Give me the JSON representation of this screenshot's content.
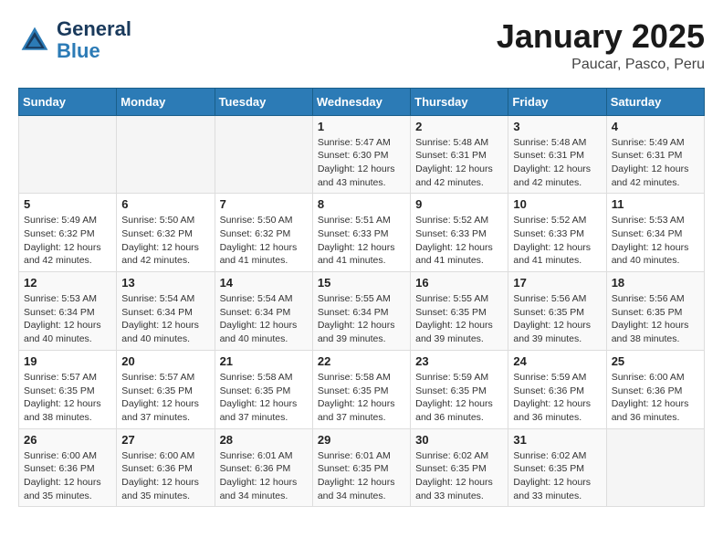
{
  "header": {
    "logo_line1": "General",
    "logo_line2": "Blue",
    "title": "January 2025",
    "subtitle": "Paucar, Pasco, Peru"
  },
  "days_of_week": [
    "Sunday",
    "Monday",
    "Tuesday",
    "Wednesday",
    "Thursday",
    "Friday",
    "Saturday"
  ],
  "weeks": [
    [
      {
        "day": "",
        "info": ""
      },
      {
        "day": "",
        "info": ""
      },
      {
        "day": "",
        "info": ""
      },
      {
        "day": "1",
        "info": "Sunrise: 5:47 AM\nSunset: 6:30 PM\nDaylight: 12 hours and 43 minutes."
      },
      {
        "day": "2",
        "info": "Sunrise: 5:48 AM\nSunset: 6:31 PM\nDaylight: 12 hours and 42 minutes."
      },
      {
        "day": "3",
        "info": "Sunrise: 5:48 AM\nSunset: 6:31 PM\nDaylight: 12 hours and 42 minutes."
      },
      {
        "day": "4",
        "info": "Sunrise: 5:49 AM\nSunset: 6:31 PM\nDaylight: 12 hours and 42 minutes."
      }
    ],
    [
      {
        "day": "5",
        "info": "Sunrise: 5:49 AM\nSunset: 6:32 PM\nDaylight: 12 hours and 42 minutes."
      },
      {
        "day": "6",
        "info": "Sunrise: 5:50 AM\nSunset: 6:32 PM\nDaylight: 12 hours and 42 minutes."
      },
      {
        "day": "7",
        "info": "Sunrise: 5:50 AM\nSunset: 6:32 PM\nDaylight: 12 hours and 41 minutes."
      },
      {
        "day": "8",
        "info": "Sunrise: 5:51 AM\nSunset: 6:33 PM\nDaylight: 12 hours and 41 minutes."
      },
      {
        "day": "9",
        "info": "Sunrise: 5:52 AM\nSunset: 6:33 PM\nDaylight: 12 hours and 41 minutes."
      },
      {
        "day": "10",
        "info": "Sunrise: 5:52 AM\nSunset: 6:33 PM\nDaylight: 12 hours and 41 minutes."
      },
      {
        "day": "11",
        "info": "Sunrise: 5:53 AM\nSunset: 6:34 PM\nDaylight: 12 hours and 40 minutes."
      }
    ],
    [
      {
        "day": "12",
        "info": "Sunrise: 5:53 AM\nSunset: 6:34 PM\nDaylight: 12 hours and 40 minutes."
      },
      {
        "day": "13",
        "info": "Sunrise: 5:54 AM\nSunset: 6:34 PM\nDaylight: 12 hours and 40 minutes."
      },
      {
        "day": "14",
        "info": "Sunrise: 5:54 AM\nSunset: 6:34 PM\nDaylight: 12 hours and 40 minutes."
      },
      {
        "day": "15",
        "info": "Sunrise: 5:55 AM\nSunset: 6:34 PM\nDaylight: 12 hours and 39 minutes."
      },
      {
        "day": "16",
        "info": "Sunrise: 5:55 AM\nSunset: 6:35 PM\nDaylight: 12 hours and 39 minutes."
      },
      {
        "day": "17",
        "info": "Sunrise: 5:56 AM\nSunset: 6:35 PM\nDaylight: 12 hours and 39 minutes."
      },
      {
        "day": "18",
        "info": "Sunrise: 5:56 AM\nSunset: 6:35 PM\nDaylight: 12 hours and 38 minutes."
      }
    ],
    [
      {
        "day": "19",
        "info": "Sunrise: 5:57 AM\nSunset: 6:35 PM\nDaylight: 12 hours and 38 minutes."
      },
      {
        "day": "20",
        "info": "Sunrise: 5:57 AM\nSunset: 6:35 PM\nDaylight: 12 hours and 37 minutes."
      },
      {
        "day": "21",
        "info": "Sunrise: 5:58 AM\nSunset: 6:35 PM\nDaylight: 12 hours and 37 minutes."
      },
      {
        "day": "22",
        "info": "Sunrise: 5:58 AM\nSunset: 6:35 PM\nDaylight: 12 hours and 37 minutes."
      },
      {
        "day": "23",
        "info": "Sunrise: 5:59 AM\nSunset: 6:35 PM\nDaylight: 12 hours and 36 minutes."
      },
      {
        "day": "24",
        "info": "Sunrise: 5:59 AM\nSunset: 6:36 PM\nDaylight: 12 hours and 36 minutes."
      },
      {
        "day": "25",
        "info": "Sunrise: 6:00 AM\nSunset: 6:36 PM\nDaylight: 12 hours and 36 minutes."
      }
    ],
    [
      {
        "day": "26",
        "info": "Sunrise: 6:00 AM\nSunset: 6:36 PM\nDaylight: 12 hours and 35 minutes."
      },
      {
        "day": "27",
        "info": "Sunrise: 6:00 AM\nSunset: 6:36 PM\nDaylight: 12 hours and 35 minutes."
      },
      {
        "day": "28",
        "info": "Sunrise: 6:01 AM\nSunset: 6:36 PM\nDaylight: 12 hours and 34 minutes."
      },
      {
        "day": "29",
        "info": "Sunrise: 6:01 AM\nSunset: 6:35 PM\nDaylight: 12 hours and 34 minutes."
      },
      {
        "day": "30",
        "info": "Sunrise: 6:02 AM\nSunset: 6:35 PM\nDaylight: 12 hours and 33 minutes."
      },
      {
        "day": "31",
        "info": "Sunrise: 6:02 AM\nSunset: 6:35 PM\nDaylight: 12 hours and 33 minutes."
      },
      {
        "day": "",
        "info": ""
      }
    ]
  ]
}
